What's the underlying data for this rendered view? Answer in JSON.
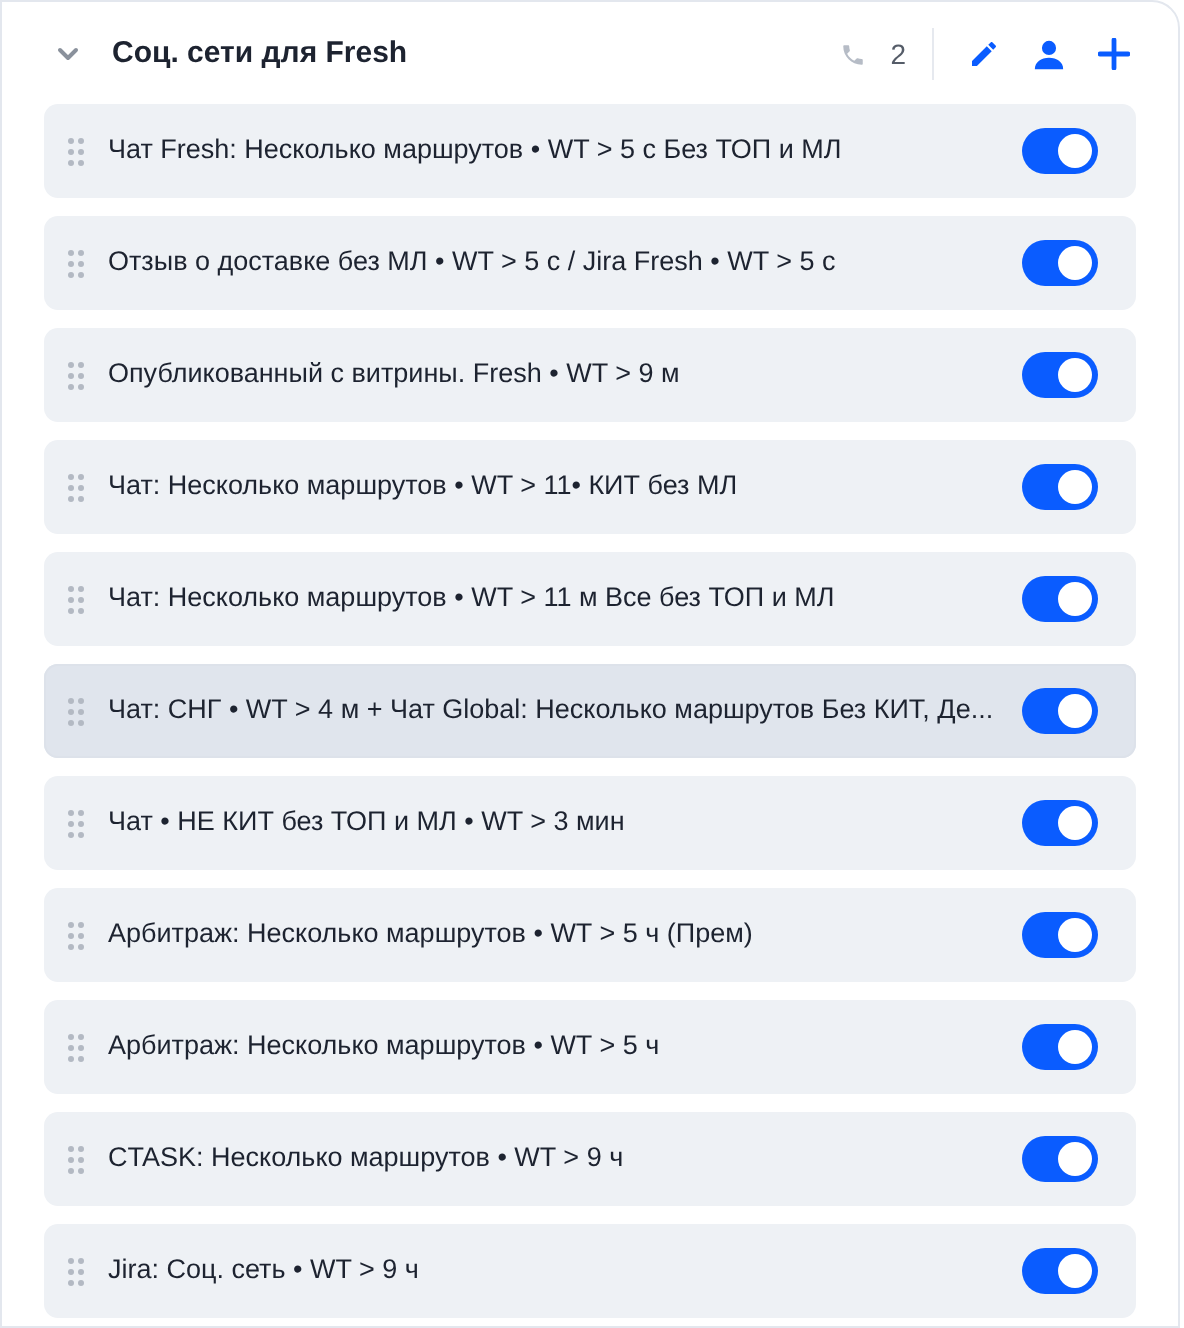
{
  "group": {
    "title": "Соц. сети для Fresh",
    "expanded": true,
    "call_count": "2"
  },
  "rules": [
    {
      "label": "Чат Fresh: Несколько маршрутов • WT > 5 с Без ТОП и МЛ",
      "on": true,
      "highlighted": false
    },
    {
      "label": "Отзыв о доставке без МЛ • WT > 5 с / Jira Fresh • WT > 5 с",
      "on": true,
      "highlighted": false
    },
    {
      "label": "Опубликованный с витрины. Fresh • WT > 9 м",
      "on": true,
      "highlighted": false
    },
    {
      "label": "Чат: Несколько маршрутов • WT > 11• КИТ без МЛ",
      "on": true,
      "highlighted": false
    },
    {
      "label": "Чат: Несколько маршрутов • WT > 11 м Все без ТОП и МЛ",
      "on": true,
      "highlighted": false
    },
    {
      "label": "Чат: СНГ • WT > 4 м + Чат Global: Несколько маршрутов Без КИТ, Де...",
      "on": true,
      "highlighted": true
    },
    {
      "label": "Чат • НЕ КИТ без ТОП и МЛ • WT > 3 мин",
      "on": true,
      "highlighted": false
    },
    {
      "label": "Арбитраж: Несколько маршрутов • WT > 5 ч (Прем)",
      "on": true,
      "highlighted": false
    },
    {
      "label": "Арбитраж: Несколько маршрутов • WT > 5 ч",
      "on": true,
      "highlighted": false
    },
    {
      "label": "CTASK: Несколько маршрутов • WT > 9 ч",
      "on": true,
      "highlighted": false
    },
    {
      "label": "Jira: Соц. сеть • WT > 9 ч",
      "on": true,
      "highlighted": false
    }
  ]
}
